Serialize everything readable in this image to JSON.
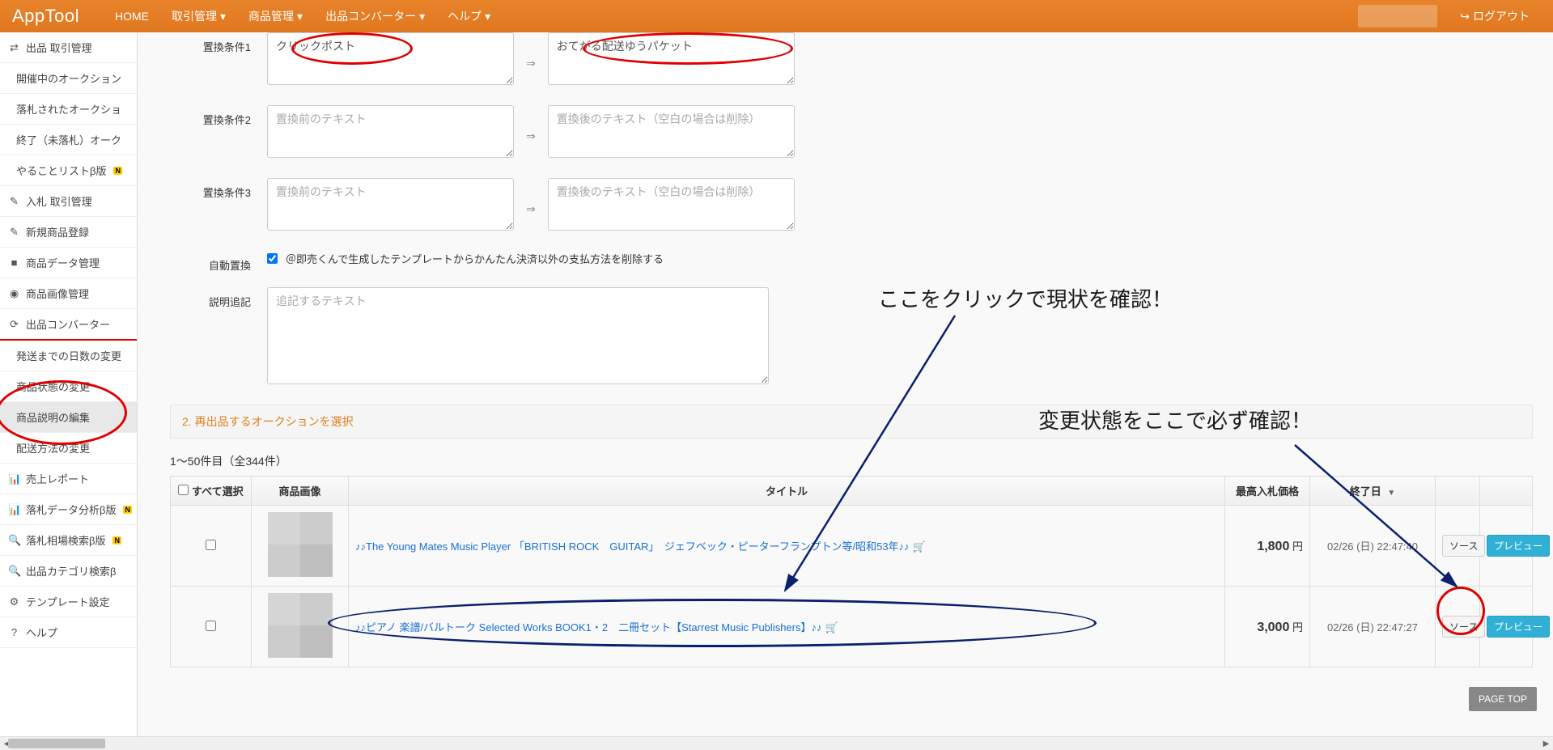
{
  "navbar": {
    "brand": "AppTool",
    "items": [
      "HOME",
      "取引管理",
      "商品管理",
      "出品コンバーター",
      "ヘルプ"
    ],
    "dropdown_indices": [
      1,
      2,
      3,
      4
    ],
    "logout": "ログアウト"
  },
  "sidebar": {
    "items": [
      {
        "icon": "⇄",
        "label": "出品 取引管理",
        "sub": false
      },
      {
        "icon": "",
        "label": "開催中のオークション",
        "sub": true
      },
      {
        "icon": "",
        "label": "落札されたオークショ",
        "sub": true
      },
      {
        "icon": "",
        "label": "終了（未落札）オーク",
        "sub": true
      },
      {
        "icon": "",
        "label": "やることリストβ版",
        "sub": true,
        "badge": "N"
      },
      {
        "icon": "✎",
        "label": "入札 取引管理",
        "sub": false
      },
      {
        "icon": "✎",
        "label": "新規商品登録",
        "sub": false
      },
      {
        "icon": "■",
        "label": "商品データ管理",
        "sub": false
      },
      {
        "icon": "◉",
        "label": "商品画像管理",
        "sub": false
      },
      {
        "icon": "⟳",
        "label": "出品コンバーター",
        "sub": false,
        "underline": true
      },
      {
        "icon": "",
        "label": "発送までの日数の変更",
        "sub": true
      },
      {
        "icon": "",
        "label": "商品状態の変更",
        "sub": true
      },
      {
        "icon": "",
        "label": "商品説明の編集",
        "sub": true,
        "active": true
      },
      {
        "icon": "",
        "label": "配送方法の変更",
        "sub": true
      },
      {
        "icon": "📊",
        "label": "売上レポート",
        "sub": false
      },
      {
        "icon": "📊",
        "label": "落札データ分析β版",
        "sub": false,
        "badge": "N"
      },
      {
        "icon": "🔍",
        "label": "落札相場検索β版",
        "sub": false,
        "badge": "N"
      },
      {
        "icon": "🔍",
        "label": "出品カテゴリ検索β",
        "sub": false
      },
      {
        "icon": "⚙",
        "label": "テンプレート設定",
        "sub": false
      },
      {
        "icon": "?",
        "label": "ヘルプ",
        "sub": false
      }
    ]
  },
  "form": {
    "cond1_label": "置換条件1",
    "cond1_before": "クリックポスト",
    "cond1_after": "おてがる配送ゆうパケット",
    "cond2_label": "置換条件2",
    "cond3_label": "置換条件3",
    "before_placeholder": "置換前のテキスト",
    "after_placeholder": "置換後のテキスト（空白の場合は削除）",
    "auto_label": "自動置換",
    "auto_text": "＠即売くんで生成したテンプレートからかんたん決済以外の支払方法を削除する",
    "append_label": "説明追記",
    "append_placeholder": "追記するテキスト",
    "arrow": "⇒"
  },
  "section": {
    "title": "2. 再出品するオークションを選択"
  },
  "count": "1〜50件目（全344件）",
  "table": {
    "headers": {
      "check": "すべて選択",
      "image": "商品画像",
      "title": "タイトル",
      "price": "最高入札価格",
      "date": "終了日"
    },
    "rows": [
      {
        "title": "♪♪The Young Mates Music Player 「BRITISH ROCK　GUITAR」　ジェフベック・ピーターフランプトン等/昭和53年♪♪",
        "price": "1,800",
        "currency": "円",
        "date": "02/26 (日) 22:47:40",
        "btn_source": "ソース",
        "btn_preview": "プレビュー"
      },
      {
        "title": "♪♪ピアノ 楽譜/バルトーク Selected Works BOOK1・2　二冊セット【Starrest Music Publishers】♪♪",
        "price": "3,000",
        "currency": "円",
        "date": "02/26 (日) 22:47:27",
        "btn_source": "ソース",
        "btn_preview": "プレビュー"
      }
    ]
  },
  "annotations": {
    "a1": "ここをクリックで現状を確認！",
    "a2": "変更状態をここで必ず確認！"
  },
  "page_top": "PAGE TOP"
}
